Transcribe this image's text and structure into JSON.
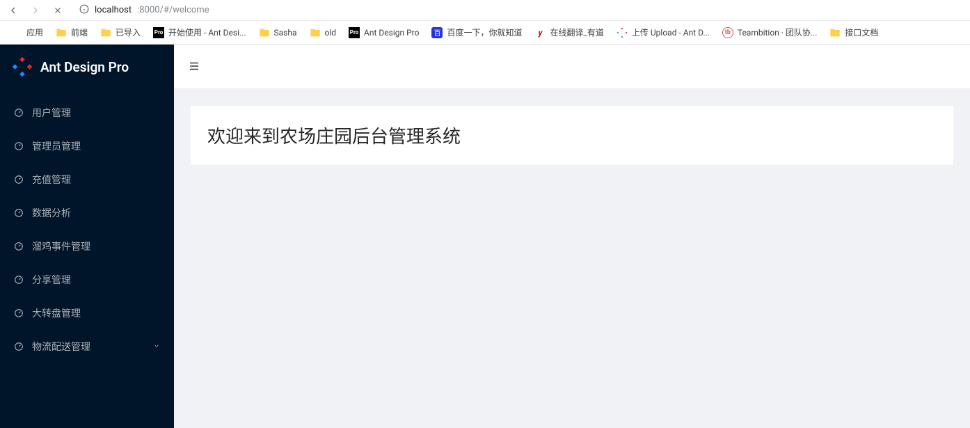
{
  "browser": {
    "url_host": "localhost",
    "url_port_path": ":8000/#/welcome"
  },
  "bookmarks": {
    "apps": "应用",
    "items": [
      {
        "label": "前端",
        "icon": "folder"
      },
      {
        "label": "已导入",
        "icon": "folder"
      },
      {
        "label": "开始使用 - Ant Desi...",
        "icon": "pro"
      },
      {
        "label": "Sasha",
        "icon": "folder"
      },
      {
        "label": "old",
        "icon": "folder"
      },
      {
        "label": "Ant Design Pro",
        "icon": "pro"
      },
      {
        "label": "百度一下，你就知道",
        "icon": "baidu"
      },
      {
        "label": "在线翻译_有道",
        "icon": "y"
      },
      {
        "label": "上传 Upload - Ant D...",
        "icon": "antd"
      },
      {
        "label": "Teambition · 团队协...",
        "icon": "tb"
      },
      {
        "label": "接口文档",
        "icon": "folder"
      }
    ]
  },
  "sidebar": {
    "brand": "Ant Design Pro",
    "items": [
      {
        "label": "用户管理",
        "expandable": false
      },
      {
        "label": "管理员管理",
        "expandable": false
      },
      {
        "label": "充值管理",
        "expandable": false
      },
      {
        "label": "数据分析",
        "expandable": false
      },
      {
        "label": "溜鸡事件管理",
        "expandable": false
      },
      {
        "label": "分享管理",
        "expandable": false
      },
      {
        "label": "大转盘管理",
        "expandable": false
      },
      {
        "label": "物流配送管理",
        "expandable": true
      }
    ]
  },
  "main": {
    "welcome_heading": "欢迎来到农场庄园后台管理系统"
  }
}
